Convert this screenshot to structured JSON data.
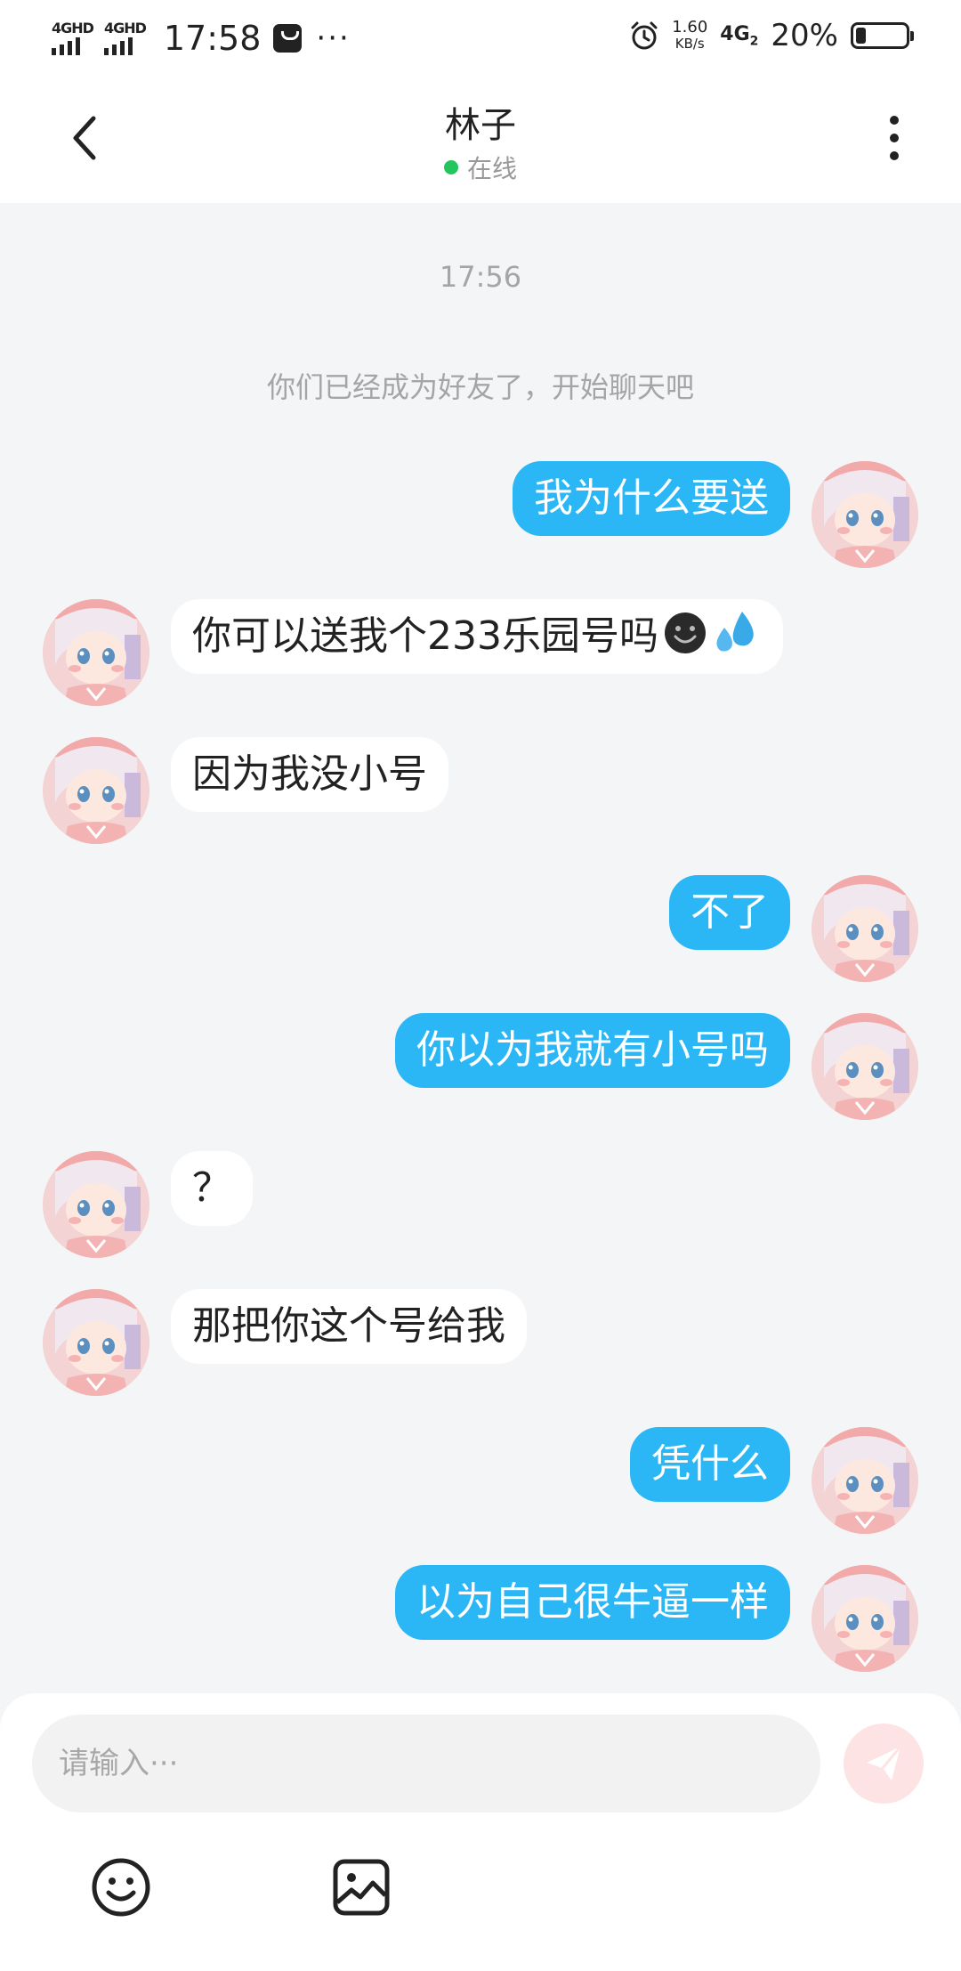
{
  "status_bar": {
    "signal1_label": "4GHD",
    "signal2_label": "4GHD",
    "time": "17:58",
    "dots": "···",
    "speed_value": "1.60",
    "speed_unit": "KB/s",
    "network": "4G",
    "network_sub": "2",
    "battery_percent": "20%",
    "battery_level": 0.2
  },
  "header": {
    "title": "林子",
    "status": "在线",
    "status_color": "#22c55e"
  },
  "chat": {
    "timestamp": "17:56",
    "system_note": "你们已经成为好友了，开始聊天吧",
    "messages": [
      {
        "side": "right",
        "text": "我为什么要送"
      },
      {
        "side": "left",
        "text": "你可以送我个233乐园号吗"
      },
      {
        "side": "left",
        "text": "因为我没小号"
      },
      {
        "side": "right",
        "text": "不了"
      },
      {
        "side": "right",
        "text": "你以为我就有小号吗"
      },
      {
        "side": "left",
        "text": "？"
      },
      {
        "side": "left",
        "text": "那把你这个号给我"
      },
      {
        "side": "right",
        "text": "凭什么"
      },
      {
        "side": "right",
        "text": "以为自己很牛逼一样"
      }
    ]
  },
  "composer": {
    "placeholder": "请输入···",
    "icons": [
      "emoji-icon",
      "image-icon",
      "send-icon"
    ]
  },
  "colors": {
    "accent": "#2bb7f5",
    "background": "#f4f5f7",
    "send_button": "#fde3e3"
  }
}
